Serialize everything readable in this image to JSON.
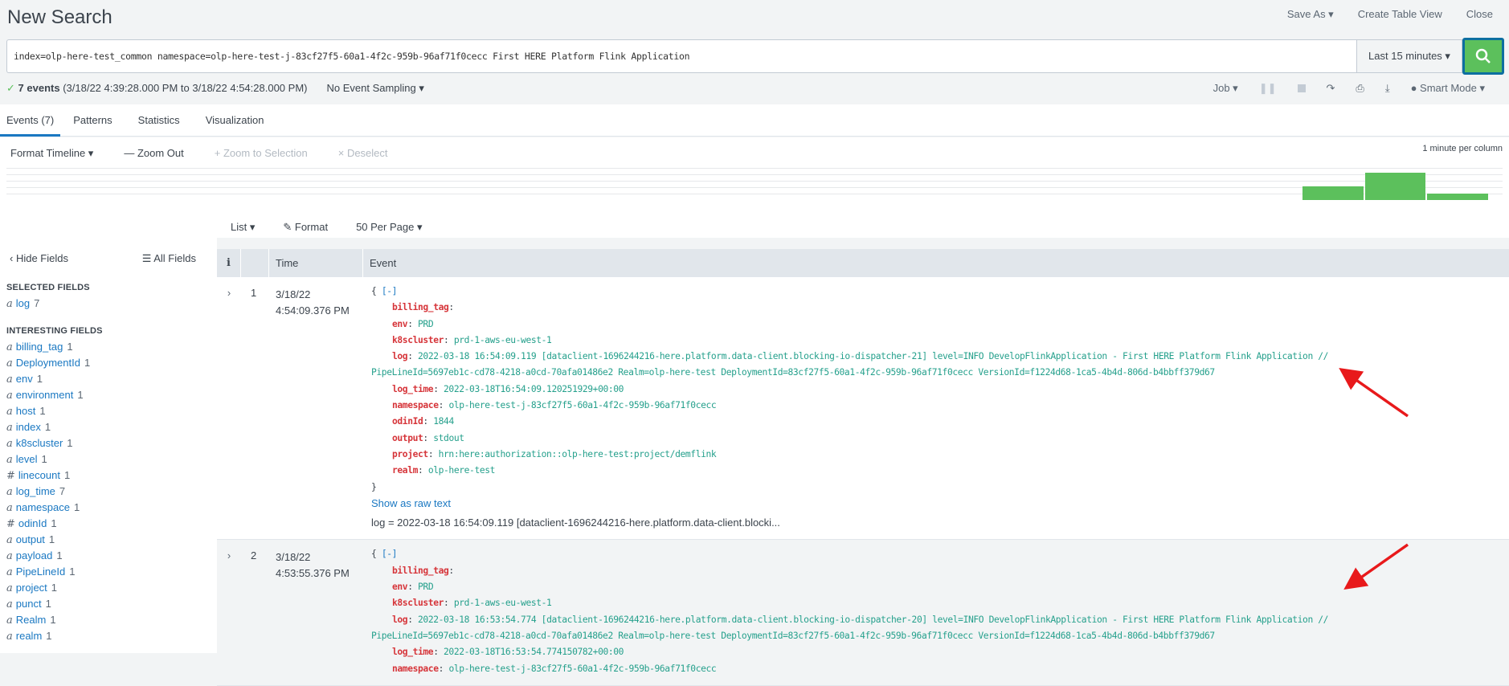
{
  "header": {
    "title": "New Search",
    "save_as": "Save As ▾",
    "create_table_view": "Create Table View",
    "close": "Close"
  },
  "search": {
    "query": "index=olp-here-test_common namespace=olp-here-test-j-83cf27f5-60a1-4f2c-959b-96af71f0cecc First HERE Platform Flink Application",
    "time_range": "Last 15 minutes ▾"
  },
  "status": {
    "check": "✓",
    "count": "7 events",
    "range": "(3/18/22 4:39:28.000 PM to 3/18/22 4:54:28.000 PM)",
    "sampling": "No Event Sampling ▾"
  },
  "job": {
    "job": "Job ▾",
    "mode": "Smart Mode ▾"
  },
  "tabs": [
    "Events (7)",
    "Patterns",
    "Statistics",
    "Visualization"
  ],
  "timeline": {
    "format": "Format Timeline ▾",
    "zoom_out": "— Zoom Out",
    "zoom_sel": "+ Zoom to Selection",
    "deselect": "× Deselect",
    "note": "1 minute per column",
    "counts": [
      0,
      0,
      0,
      0,
      0,
      0,
      0,
      0,
      0,
      0,
      0,
      0,
      2,
      4,
      1
    ]
  },
  "list": {
    "list": "List ▾",
    "format": "✎ Format",
    "per_page": "50 Per Page ▾"
  },
  "sidebar": {
    "hide": "‹ Hide Fields",
    "all": "☰ All Fields",
    "selected_title": "SELECTED FIELDS",
    "interesting_title": "INTERESTING FIELDS",
    "selected": [
      {
        "t": "a",
        "n": "log",
        "c": "7"
      }
    ],
    "interesting": [
      {
        "t": "a",
        "n": "billing_tag",
        "c": "1"
      },
      {
        "t": "a",
        "n": "DeploymentId",
        "c": "1"
      },
      {
        "t": "a",
        "n": "env",
        "c": "1"
      },
      {
        "t": "a",
        "n": "environment",
        "c": "1"
      },
      {
        "t": "a",
        "n": "host",
        "c": "1"
      },
      {
        "t": "a",
        "n": "index",
        "c": "1"
      },
      {
        "t": "a",
        "n": "k8scluster",
        "c": "1"
      },
      {
        "t": "a",
        "n": "level",
        "c": "1"
      },
      {
        "t": "#",
        "n": "linecount",
        "c": "1"
      },
      {
        "t": "a",
        "n": "log_time",
        "c": "7"
      },
      {
        "t": "a",
        "n": "namespace",
        "c": "1"
      },
      {
        "t": "#",
        "n": "odinId",
        "c": "1"
      },
      {
        "t": "a",
        "n": "output",
        "c": "1"
      },
      {
        "t": "a",
        "n": "payload",
        "c": "1"
      },
      {
        "t": "a",
        "n": "PipeLineId",
        "c": "1"
      },
      {
        "t": "a",
        "n": "project",
        "c": "1"
      },
      {
        "t": "a",
        "n": "punct",
        "c": "1"
      },
      {
        "t": "a",
        "n": "Realm",
        "c": "1"
      },
      {
        "t": "a",
        "n": "realm",
        "c": "1"
      }
    ]
  },
  "table": {
    "col_i": "i",
    "col_time": "Time",
    "col_event": "Event",
    "show_raw": "Show as raw text",
    "open": "{",
    "collapse": "[-]",
    "close": "}"
  },
  "events": [
    {
      "num": "1",
      "date": "3/18/22",
      "time": "4:54:09.376 PM",
      "fields": [
        [
          "billing_tag",
          ""
        ],
        [
          "env",
          "PRD"
        ],
        [
          "k8scluster",
          "prd-1-aws-eu-west-1"
        ],
        [
          "log",
          "2022-03-18 16:54:09.119 [dataclient-1696244216-here.platform.data-client.blocking-io-dispatcher-21] level=INFO  DevelopFlinkApplication  - First HERE Platform Flink Application //"
        ],
        [
          "",
          "PipeLineId=5697eb1c-cd78-4218-a0cd-70afa01486e2 Realm=olp-here-test DeploymentId=83cf27f5-60a1-4f2c-959b-96af71f0cecc VersionId=f1224d68-1ca5-4b4d-806d-b4bbff379d67"
        ],
        [
          "log_time",
          "2022-03-18T16:54:09.120251929+00:00"
        ],
        [
          "namespace",
          "olp-here-test-j-83cf27f5-60a1-4f2c-959b-96af71f0cecc"
        ],
        [
          "odinId",
          "1844"
        ],
        [
          "output",
          "stdout"
        ],
        [
          "project",
          "hrn:here:authorization::olp-here-test:project/demflink"
        ],
        [
          "realm",
          "olp-here-test"
        ]
      ],
      "summary": "log = 2022-03-18 16:54:09.119 [dataclient-1696244216-here.platform.data-client.blocki..."
    },
    {
      "num": "2",
      "date": "3/18/22",
      "time": "4:53:55.376 PM",
      "fields": [
        [
          "billing_tag",
          ""
        ],
        [
          "env",
          "PRD"
        ],
        [
          "k8scluster",
          "prd-1-aws-eu-west-1"
        ],
        [
          "log",
          "2022-03-18 16:53:54.774 [dataclient-1696244216-here.platform.data-client.blocking-io-dispatcher-20] level=INFO  DevelopFlinkApplication  - First HERE Platform Flink Application //"
        ],
        [
          "",
          "PipeLineId=5697eb1c-cd78-4218-a0cd-70afa01486e2 Realm=olp-here-test DeploymentId=83cf27f5-60a1-4f2c-959b-96af71f0cecc VersionId=f1224d68-1ca5-4b4d-806d-b4bbff379d67"
        ],
        [
          "log_time",
          "2022-03-18T16:53:54.774150782+00:00"
        ],
        [
          "namespace",
          "olp-here-test-j-83cf27f5-60a1-4f2c-959b-96af71f0cecc"
        ]
      ]
    }
  ],
  "colors": {
    "accent": "#1a78c2",
    "green": "#5cc05c",
    "key": "#d6353a",
    "value": "#25a08c",
    "arrow": "#e8191b"
  }
}
